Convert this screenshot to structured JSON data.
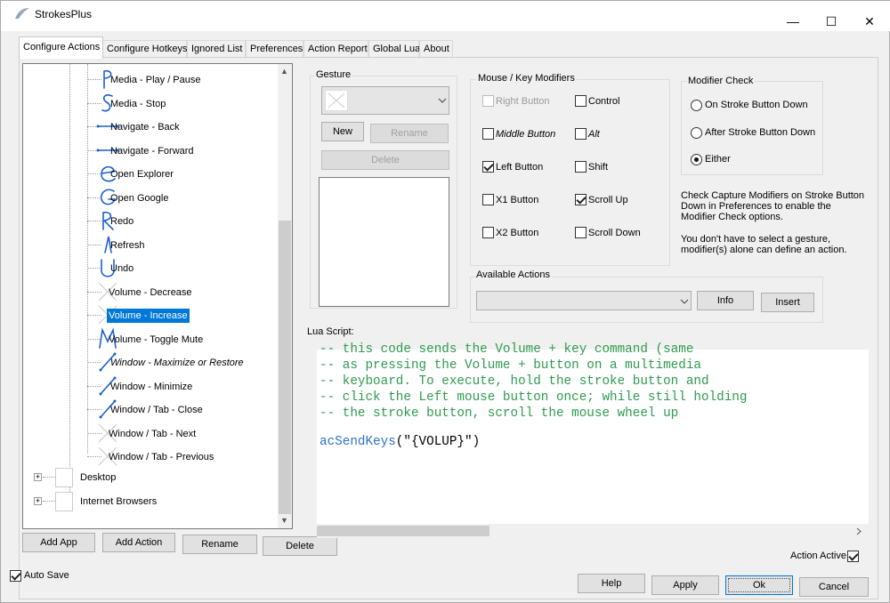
{
  "window": {
    "title": "StrokesPlus",
    "minimize": "—",
    "maximize": "☐",
    "close": "✕"
  },
  "tabs": [
    "Configure Actions",
    "Configure Hotkeys",
    "Ignored List",
    "Preferences",
    "Action Report",
    "Global Lua",
    "About"
  ],
  "tree": {
    "items": [
      {
        "label": "Media - Play / Pause",
        "glyph": "P"
      },
      {
        "label": "Media - Stop",
        "glyph": "S"
      },
      {
        "label": "Navigate - Back",
        "glyph": "line"
      },
      {
        "label": "Navigate - Forward",
        "glyph": "line"
      },
      {
        "label": "Open Explorer",
        "glyph": "e"
      },
      {
        "label": "Open Google",
        "glyph": "G"
      },
      {
        "label": "Redo",
        "glyph": "R"
      },
      {
        "label": "Refresh",
        "glyph": "refresh"
      },
      {
        "label": "Undo",
        "glyph": "U"
      },
      {
        "label": "Volume - Decrease",
        "glyph": "x"
      },
      {
        "label": "Volume - Increase",
        "glyph": "x"
      },
      {
        "label": "Volume - Toggle Mute",
        "glyph": "M"
      },
      {
        "label": "Window - Maximize or Restore",
        "glyph": "diag"
      },
      {
        "label": "Window - Minimize",
        "glyph": "diag"
      },
      {
        "label": "Window / Tab - Close",
        "glyph": "diag"
      },
      {
        "label": "Window / Tab - Next",
        "glyph": "x"
      },
      {
        "label": "Window / Tab - Previous",
        "glyph": "x"
      }
    ],
    "groups": [
      {
        "label": "Desktop"
      },
      {
        "label": "Internet Browsers"
      }
    ],
    "scroll_up": "▲",
    "scroll_down": "▼"
  },
  "tree_buttons": {
    "add_app": "Add App",
    "add_action": "Add Action",
    "rename": "Rename",
    "delete": "Delete"
  },
  "auto_save": {
    "label": "Auto Save",
    "checked": true
  },
  "gesture": {
    "label": "Gesture",
    "new": "New",
    "rename": "Rename",
    "delete": "Delete"
  },
  "modifiers": {
    "label": "Mouse / Key Modifiers",
    "items": [
      {
        "label": "Right Button",
        "checked": false,
        "disabled": true
      },
      {
        "label": "Control",
        "checked": false
      },
      {
        "label": "Middle Button",
        "checked": false,
        "italic": true
      },
      {
        "label": "Alt",
        "checked": false,
        "italic": true
      },
      {
        "label": "Left Button",
        "checked": true
      },
      {
        "label": "Shift",
        "checked": false
      },
      {
        "label": "X1 Button",
        "checked": false
      },
      {
        "label": "Scroll Up",
        "checked": true
      },
      {
        "label": "X2 Button",
        "checked": false
      },
      {
        "label": "Scroll Down",
        "checked": false
      }
    ]
  },
  "modifier_check": {
    "label": "Modifier Check",
    "options": [
      "On Stroke Button Down",
      "After Stroke Button Down",
      "Either"
    ],
    "selected": "Either",
    "note1": "Check Capture Modifiers on Stroke Button Down in Preferences to enable the Modifier Check options.",
    "note2": "You don't have to select a gesture, modifier(s) alone can define an action."
  },
  "available_actions": {
    "label": "Available Actions",
    "info": "Info",
    "insert": "Insert"
  },
  "lua": {
    "label": "Lua Script:",
    "comment_lines": [
      "-- this code sends the Volume + key command (same",
      "-- as pressing the Volume + button on a multimedia",
      "-- keyboard. To execute, hold the stroke button and",
      "-- click the Left mouse button once; while still holding",
      "-- the stroke button, scroll the mouse wheel up"
    ],
    "call_fn": "acSendKeys",
    "call_args": "(\"{VOLUP}\")"
  },
  "action_active": {
    "label": "Action Active",
    "checked": true
  },
  "dialog_buttons": {
    "help": "Help",
    "apply": "Apply",
    "ok": "Ok",
    "cancel": "Cancel"
  },
  "colors": {
    "accent": "#0078d7",
    "comment": "#2f9a4f",
    "function": "#2b74c9",
    "glyph": "#1c5fd0"
  }
}
